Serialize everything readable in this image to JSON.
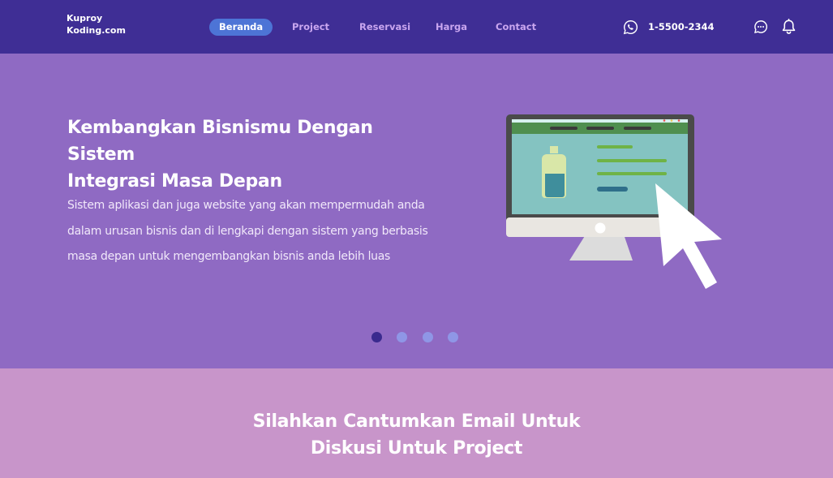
{
  "header": {
    "brand_line1": "Kuproy",
    "brand_line2": "Koding.com",
    "nav": [
      {
        "label": "Beranda",
        "active": true
      },
      {
        "label": "Project",
        "active": false
      },
      {
        "label": "Reservasi",
        "active": false
      },
      {
        "label": "Harga",
        "active": false
      },
      {
        "label": "Contact",
        "active": false
      }
    ],
    "phone": "1-5500-2344",
    "icons": [
      "whatsapp-icon",
      "chat-icon",
      "bell-icon"
    ]
  },
  "hero": {
    "title_line1": "Kembangkan Bisnismu Dengan Sistem",
    "title_line2": "Integrasi Masa Depan",
    "desc_line1": "Sistem aplikasi dan juga website yang akan mempermudah anda",
    "desc_line2": "dalam urusan bisnis dan di lengkapi dengan sistem yang berbasis",
    "desc_line3": "masa depan untuk mengembangkan bisnis anda lebih luas",
    "illustration": "monitor-with-cursor-illustration",
    "slides_total": 4,
    "active_slide": 1
  },
  "cta": {
    "line1": "Silahkan Cantumkan Email Untuk",
    "line2": "Diskusi Untuk Project"
  },
  "colors": {
    "navbar": "#3f2e95",
    "hero": "#8f6ac3",
    "cta": "#c895ca",
    "active_pill": "#4d74d6",
    "nav_text": "#c9a6ef",
    "dot": "#8f96e6",
    "dot_active": "#3a2a8e"
  }
}
